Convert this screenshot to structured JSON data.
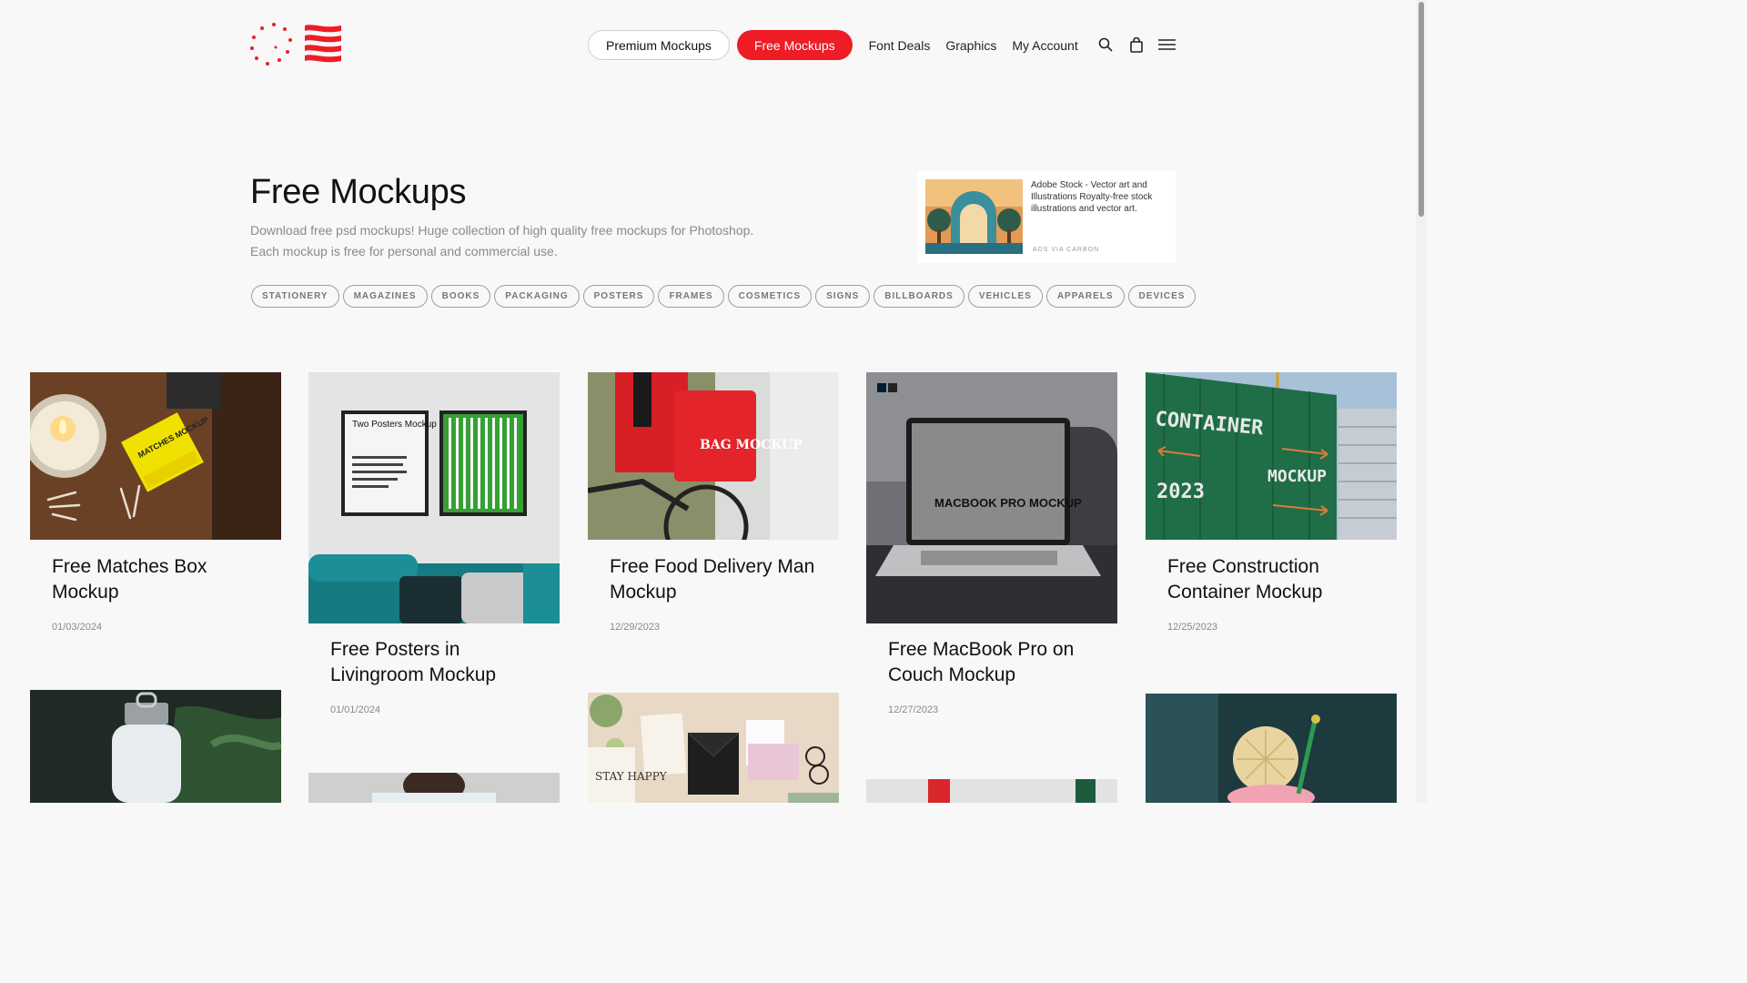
{
  "header": {
    "nav": {
      "premium_label": "Premium Mockups",
      "free_label": "Free Mockups",
      "links": [
        "Font Deals",
        "Graphics",
        "My Account"
      ]
    },
    "icons": [
      "search-icon",
      "shopping-bag-icon",
      "hamburger-menu-icon"
    ]
  },
  "colors": {
    "brand_red": "#ee1c25",
    "background": "#f8f8f8"
  },
  "hero": {
    "title": "Free Mockups",
    "desc_line1": "Download free psd mockups! Huge collection of high quality free mockups for Photoshop.",
    "desc_line2": "Each mockup is free for personal and commercial use."
  },
  "ad": {
    "text": "Adobe Stock - Vector art and Illustrations Royalty-free stock illustrations and vector art.",
    "via": "ADS VIA CARBON"
  },
  "categories": [
    "STATIONERY",
    "MAGAZINES",
    "BOOKS",
    "PACKAGING",
    "POSTERS",
    "FRAMES",
    "COSMETICS",
    "SIGNS",
    "BILLBOARDS",
    "VEHICLES",
    "APPARELS",
    "DEVICES"
  ],
  "cards": [
    {
      "title": "Free Matches Box Mockup",
      "date": "01/03/2024",
      "image_text": "MATCHES MOCKUP"
    },
    {
      "title": "Free Posters in Livingroom Mockup",
      "date": "01/01/2024",
      "image_text": "Two Posters Mockup"
    },
    {
      "title": "Free Food Delivery Man Mockup",
      "date": "12/29/2023",
      "image_text": "BAG MOCKUP"
    },
    {
      "title": "Free MacBook Pro on Couch Mockup",
      "date": "12/27/2023",
      "image_text": "MACBOOK PRO MOCKUP"
    },
    {
      "title": "Free Construction Container Mockup",
      "date": "12/25/2023",
      "image_text_1": "CONTAINER",
      "image_text_2": "MOCKUP",
      "image_text_3": "2023"
    }
  ],
  "second_row": {
    "stationery_text": "STAY HAPPY"
  }
}
